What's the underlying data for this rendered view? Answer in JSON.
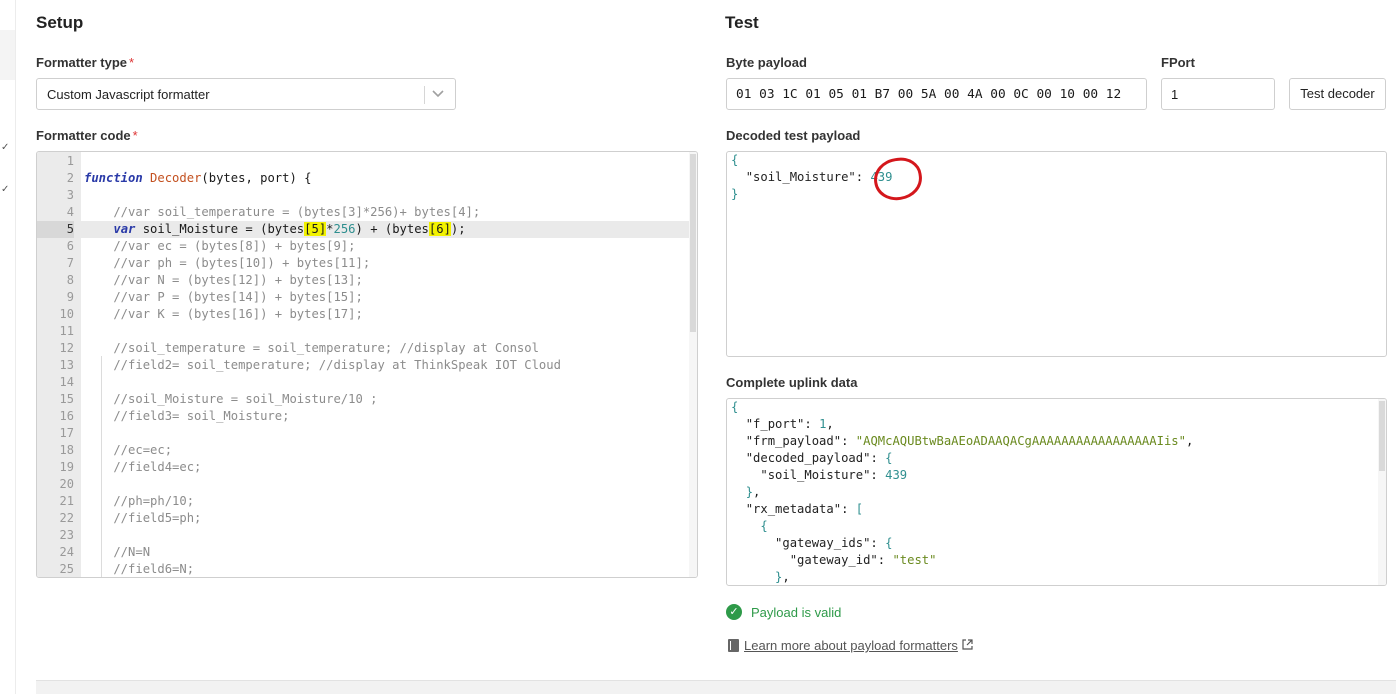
{
  "setup": {
    "title": "Setup",
    "formatter_type_label": "Formatter type",
    "required_mark": "*",
    "formatter_type_value": "Custom Javascript formatter",
    "formatter_code_label": "Formatter code",
    "code_lines": [
      {
        "n": "1",
        "t": ""
      },
      {
        "n": "2",
        "t": "function Decoder(bytes, port) {"
      },
      {
        "n": "3",
        "t": ""
      },
      {
        "n": "4",
        "t": "    //var soil_temperature = (bytes[3]*256)+ bytes[4];"
      },
      {
        "n": "5",
        "t": "    var soil_Moisture = (bytes[5]*256) + (bytes[6]);"
      },
      {
        "n": "6",
        "t": "    //var ec = (bytes[8]) + bytes[9];"
      },
      {
        "n": "7",
        "t": "    //var ph = (bytes[10]) + bytes[11];"
      },
      {
        "n": "8",
        "t": "    //var N = (bytes[12]) + bytes[13];"
      },
      {
        "n": "9",
        "t": "    //var P = (bytes[14]) + bytes[15];"
      },
      {
        "n": "10",
        "t": "    //var K = (bytes[16]) + bytes[17];"
      },
      {
        "n": "11",
        "t": ""
      },
      {
        "n": "12",
        "t": "    //soil_temperature = soil_temperature; //display at Consol"
      },
      {
        "n": "13",
        "t": "    //field2= soil_temperature; //display at ThinkSpeak IOT Cloud"
      },
      {
        "n": "14",
        "t": ""
      },
      {
        "n": "15",
        "t": "    //soil_Moisture = soil_Moisture/10 ;"
      },
      {
        "n": "16",
        "t": "    //field3= soil_Moisture;"
      },
      {
        "n": "17",
        "t": ""
      },
      {
        "n": "18",
        "t": "    //ec=ec;"
      },
      {
        "n": "19",
        "t": "    //field4=ec;"
      },
      {
        "n": "20",
        "t": ""
      },
      {
        "n": "21",
        "t": "    //ph=ph/10;"
      },
      {
        "n": "22",
        "t": "    //field5=ph;"
      },
      {
        "n": "23",
        "t": ""
      },
      {
        "n": "24",
        "t": "    //N=N"
      },
      {
        "n": "25",
        "t": "    //field6=N;"
      }
    ]
  },
  "test": {
    "title": "Test",
    "byte_payload_label": "Byte payload",
    "byte_payload_value": "01 03 1C 01 05 01 B7 00 5A 00 4A 00 0C 00 10 00 12",
    "fport_label": "FPort",
    "fport_value": "1",
    "test_decoder_label": "Test decoder",
    "decoded_label": "Decoded test payload",
    "decoded_key": "\"soil_Moisture\"",
    "decoded_value": "439",
    "uplink_label": "Complete uplink data",
    "uplink": {
      "f_port_key": "\"f_port\"",
      "f_port_value": "1",
      "frm_payload_key": "\"frm_payload\"",
      "frm_payload_value": "\"AQMcAQUBtwBaAEoADAAQACgAAAAAAAAAAAAAAAAAIis\"",
      "decoded_payload_key": "\"decoded_payload\"",
      "soil_key": "\"soil_Moisture\"",
      "soil_value": "439",
      "rx_metadata_key": "\"rx_metadata\"",
      "gateway_ids_key": "\"gateway_ids\"",
      "gateway_id_key": "\"gateway_id\"",
      "gateway_id_value": "\"test\""
    },
    "status_text": "Payload is valid",
    "learn_link": "Learn more about payload formatters"
  },
  "colors": {
    "valid": "#2e9a49",
    "annotation": "#d4171c",
    "highlight": "#f2f200"
  },
  "icons": [
    "chevron-down-icon",
    "check-circle-icon",
    "book-icon",
    "external-link-icon"
  ]
}
